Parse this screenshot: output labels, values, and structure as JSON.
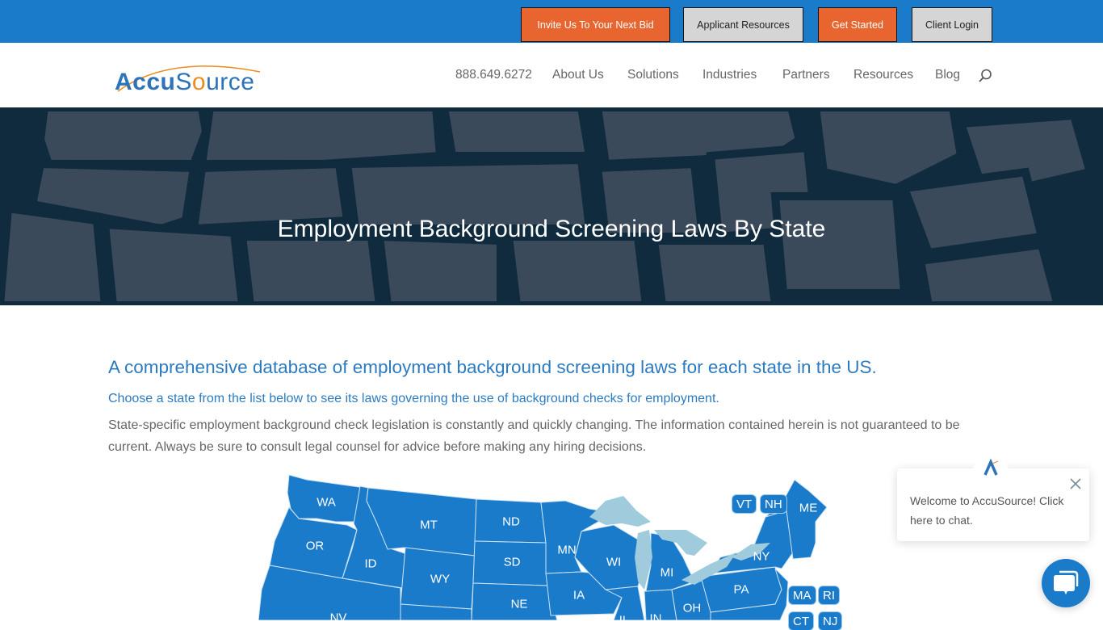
{
  "topbar": {
    "buttons": [
      {
        "label": "Invite Us To Your Next Bid",
        "style": "orange"
      },
      {
        "label": "Applicant Resources",
        "style": "grey"
      },
      {
        "label": "Get Started",
        "style": "orange"
      },
      {
        "label": "Client Login",
        "style": "grey"
      }
    ]
  },
  "header": {
    "logo": {
      "part1": "Accu",
      "part2": "S",
      "part3": "o",
      "part4": "urce",
      "icon": "accusource-logo"
    },
    "phone": "888.649.6272",
    "nav": [
      "About Us",
      "Solutions",
      "Industries",
      "Partners",
      "Resources",
      "Blog"
    ],
    "search_icon": "search-icon"
  },
  "hero": {
    "title": "Employment Background Screening Laws By State"
  },
  "content": {
    "heading": "A comprehensive database of employment background screening laws for each state in the US.",
    "subheading": "Choose a state from the list below to see its laws governing the use of background checks for employment.",
    "paragraph": "State-specific employment background check legislation is constantly and quickly changing. The information contained herein is not guaranteed to be current. Always be sure to consult legal counsel for advice before making any hiring decisions."
  },
  "map": {
    "states": [
      "WA",
      "OR",
      "ID",
      "MT",
      "WY",
      "ND",
      "SD",
      "NE",
      "NV",
      "MN",
      "IA",
      "WI",
      "MI",
      "IL",
      "IN",
      "OH",
      "PA",
      "NY",
      "ME"
    ],
    "boxed_states": [
      "VT",
      "NH",
      "MA",
      "RI",
      "CT",
      "NJ"
    ]
  },
  "colors": {
    "brand_blue": "#1b7bcb",
    "cta_orange": "#e8652f",
    "lake_blue": "#9fcbdd",
    "hero_dark": "#0f2b3d"
  },
  "chat": {
    "message": "Welcome to AccuSource! Click here to chat.",
    "close_icon": "close-icon",
    "launcher_icon": "chat-bubble-icon"
  }
}
